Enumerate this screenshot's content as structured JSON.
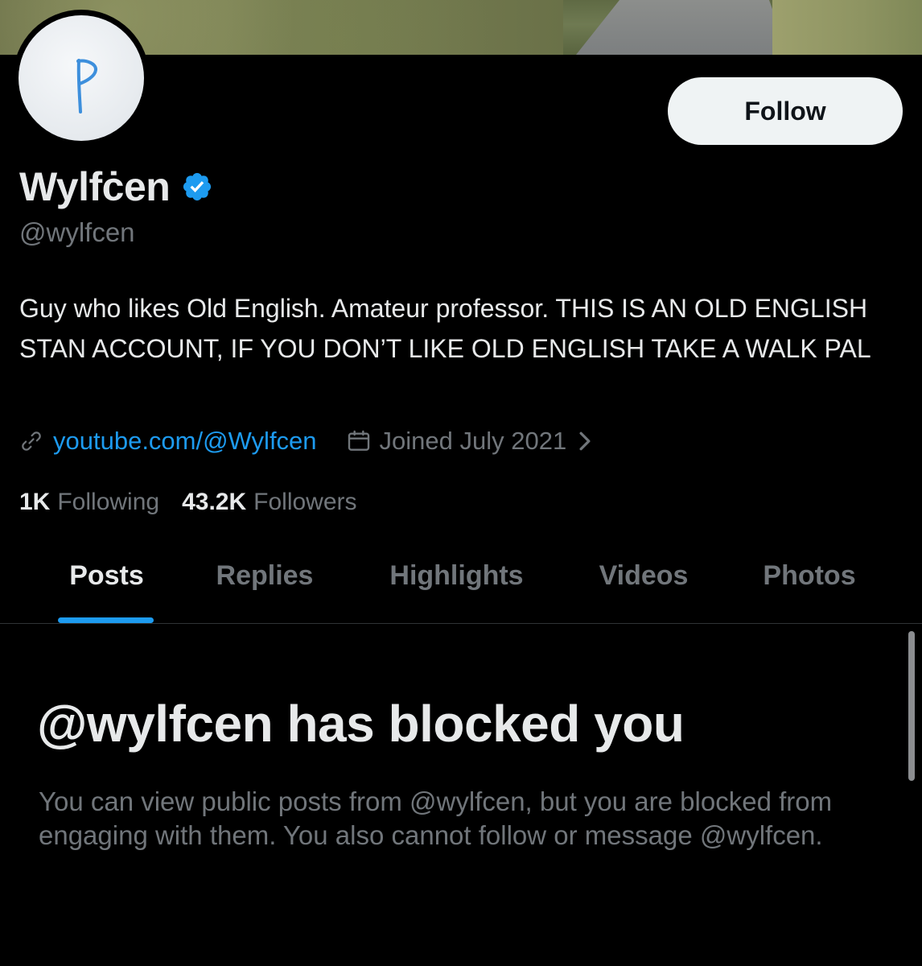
{
  "profile": {
    "display_name": "Wylfċen",
    "handle": "@wylfcen",
    "avatar_letter": "ᚹ",
    "verified_icon": "verified-badge-icon",
    "bio": "Guy who likes Old English. Amateur professor. THIS IS AN OLD ENGLISH STAN ACCOUNT, IF YOU DON’T LIKE OLD ENGLISH TAKE A WALK PAL",
    "website": "youtube.com/@Wylfcen",
    "joined": "Joined July 2021"
  },
  "actions": {
    "follow_label": "Follow"
  },
  "stats": {
    "following_count": "1K",
    "following_label": "Following",
    "followers_count": "43.2K",
    "followers_label": "Followers"
  },
  "tabs": [
    {
      "label": "Posts",
      "active": true
    },
    {
      "label": "Replies",
      "active": false
    },
    {
      "label": "Highlights",
      "active": false
    },
    {
      "label": "Videos",
      "active": false
    },
    {
      "label": "Photos",
      "active": false
    }
  ],
  "blocked": {
    "title": "@wylfcen has blocked you",
    "description": "You can view public posts from @wylfcen, but you are blocked from engaging with them. You also cannot follow or message @wylfcen."
  },
  "colors": {
    "background": "#000000",
    "accent": "#1d9bf0",
    "text_primary": "#e7e9ea",
    "text_secondary": "#71767b",
    "button_bg": "#eff3f4"
  }
}
